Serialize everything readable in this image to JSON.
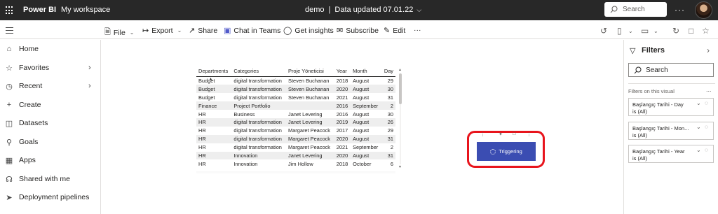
{
  "topbar": {
    "brand": "Power BI",
    "workspace": "My workspace",
    "report_name": "demo",
    "updated": "Data updated 07.01.22",
    "search_placeholder": "Search",
    "more": "···"
  },
  "toolbar": {
    "file": "File",
    "export": "Export",
    "share": "Share",
    "teams": "Chat in Teams",
    "insights": "Get insights",
    "subscribe": "Subscribe",
    "edit": "Edit",
    "more": "···"
  },
  "sidebar": {
    "items": [
      {
        "label": "Home",
        "icon": "home-icon"
      },
      {
        "label": "Favorites",
        "icon": "star-icon"
      },
      {
        "label": "Recent",
        "icon": "clock-icon"
      },
      {
        "label": "Create",
        "icon": "plus-icon"
      },
      {
        "label": "Datasets",
        "icon": "database-icon"
      },
      {
        "label": "Goals",
        "icon": "trophy-icon"
      },
      {
        "label": "Apps",
        "icon": "apps-icon"
      },
      {
        "label": "Shared with me",
        "icon": "share-icon"
      },
      {
        "label": "Deployment pipelines",
        "icon": "rocket-icon"
      }
    ]
  },
  "table": {
    "headers": [
      "Departments",
      "Categories",
      "Proje Yöneticisi",
      "Year",
      "Month",
      "Day"
    ],
    "rows": [
      [
        "Budget",
        "digital transformation",
        "Steven Buchanan",
        "2018",
        "August",
        "29"
      ],
      [
        "Budget",
        "digital transformation",
        "Steven Buchanan",
        "2020",
        "August",
        "30"
      ],
      [
        "Budget",
        "digital transformation",
        "Steven Buchanan",
        "2021",
        "August",
        "31"
      ],
      [
        "Finance",
        "Project Portfolio",
        "",
        "2016",
        "September",
        "2"
      ],
      [
        "HR",
        "Business",
        "Janet Levering",
        "2016",
        "August",
        "30"
      ],
      [
        "HR",
        "digital transformation",
        "Janet Levering",
        "2019",
        "August",
        "26"
      ],
      [
        "HR",
        "digital transformation",
        "Margaret Peacock",
        "2017",
        "August",
        "29"
      ],
      [
        "HR",
        "digital transformation",
        "Margaret Peacock",
        "2020",
        "August",
        "31"
      ],
      [
        "HR",
        "digital transformation",
        "Margaret Peacock",
        "2021",
        "September",
        "2"
      ],
      [
        "HR",
        "Innovation",
        "Janet Levering",
        "2020",
        "August",
        "31"
      ],
      [
        "HR",
        "Innovation",
        "Jim Hollow",
        "2018",
        "October",
        "6"
      ]
    ]
  },
  "button_visual": {
    "label": "Triggering"
  },
  "filters": {
    "title": "Filters",
    "search_placeholder": "Search",
    "section": "Filters on this visual",
    "section_more": "...",
    "cards": [
      {
        "line1": "Başlangıç Tarihi - Day",
        "line2": "is (All)"
      },
      {
        "line1": "Başlangıç Tarihi - Mon...",
        "line2": "is (All)"
      },
      {
        "line1": "Başlangıç Tarihi - Year",
        "line2": "is (All)"
      }
    ]
  },
  "colors": {
    "topbar_bg": "#282828",
    "button_bg": "#3b4db2",
    "highlight_border": "#e8141c"
  }
}
